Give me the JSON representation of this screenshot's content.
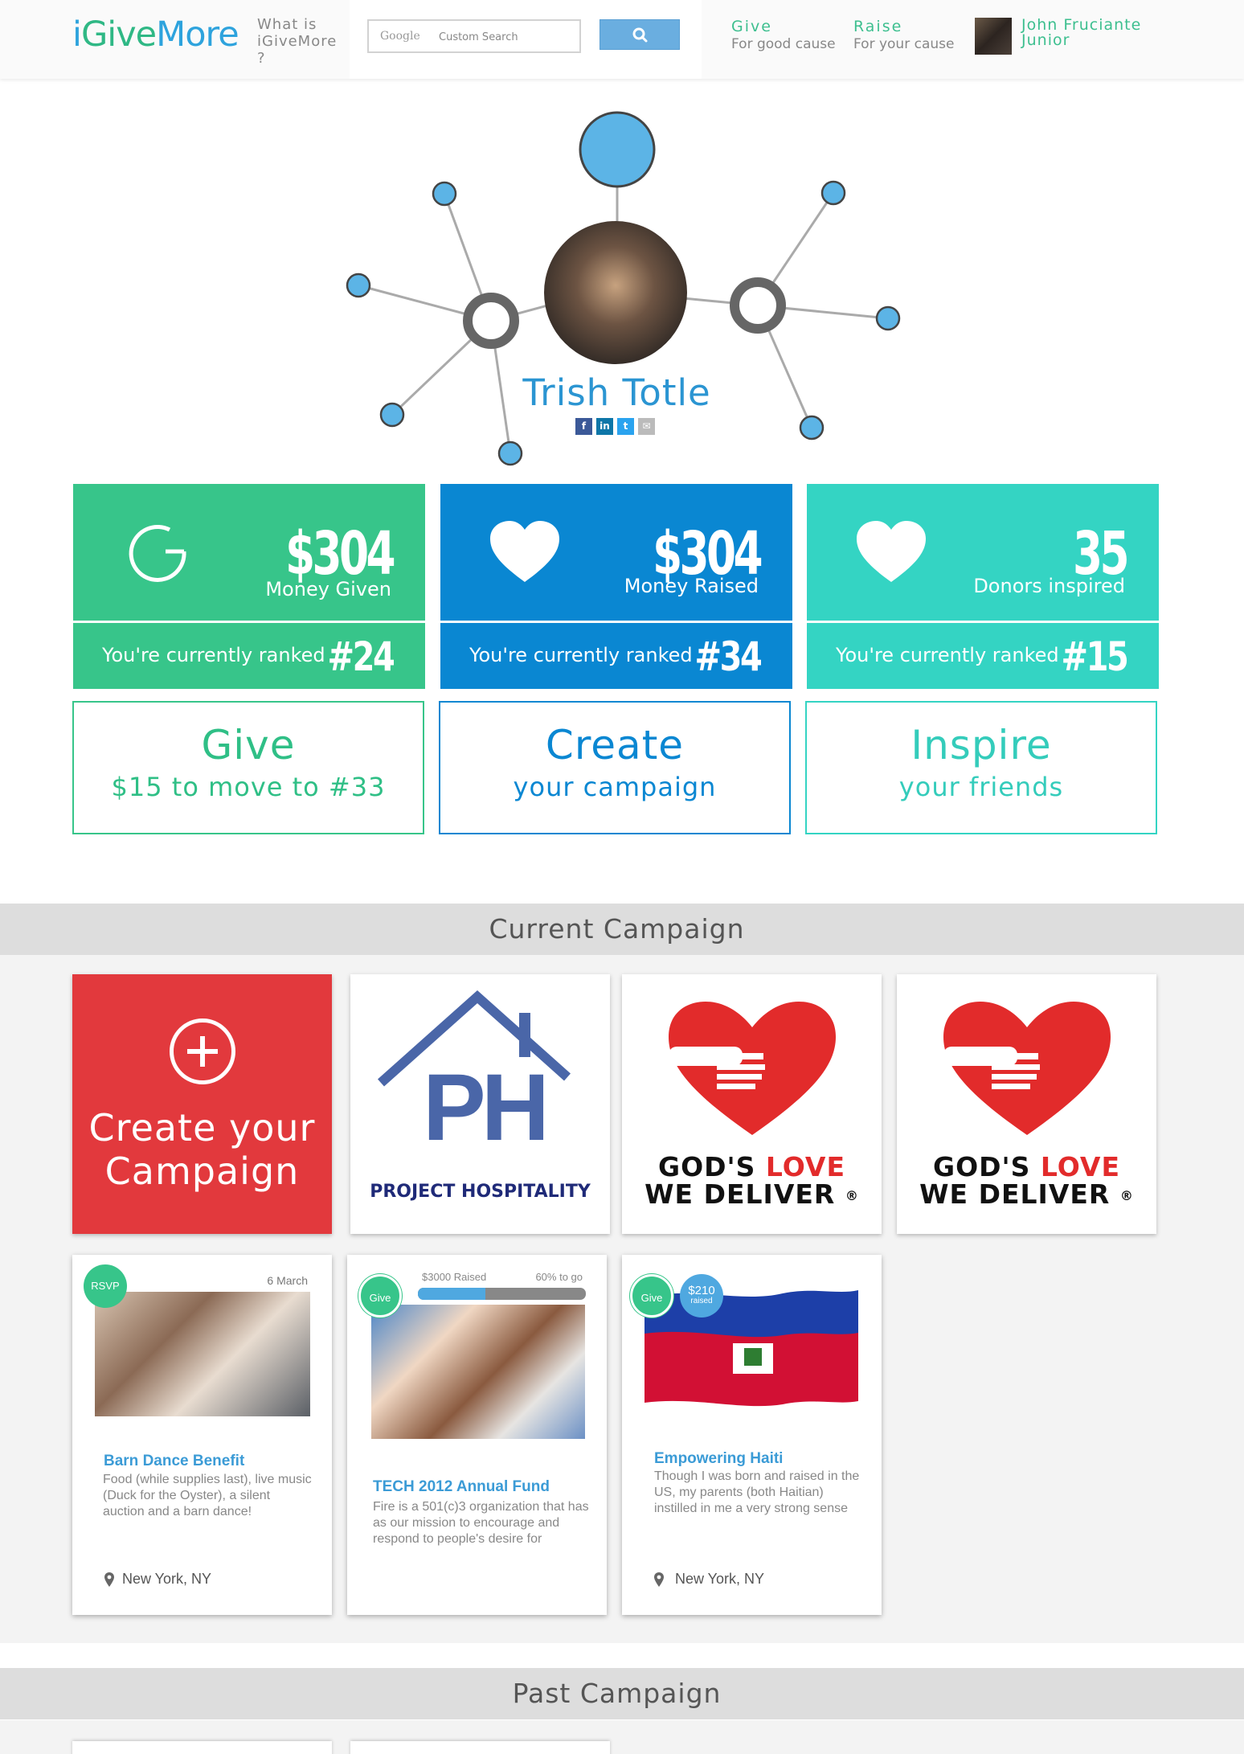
{
  "header": {
    "logo": {
      "i": "i",
      "give": "Give",
      "more": "More"
    },
    "what_is": "What is iGiveMore ?",
    "search": {
      "google_label": "Google",
      "placeholder": "Custom Search"
    },
    "nav": [
      {
        "title": "Give",
        "subtitle": "For good cause"
      },
      {
        "title": "Raise",
        "subtitle": "For your cause"
      }
    ],
    "user": {
      "name_line1": "John Fruciante",
      "name_line2": "Junior"
    }
  },
  "profile": {
    "name": "Trish Totle",
    "socials": [
      "f",
      "in",
      "t",
      "✉"
    ]
  },
  "stats": [
    {
      "amount": "$304",
      "label": "Money Given",
      "rank_text": "You're currently ranked",
      "rank": "#24",
      "icon": "give-logo-icon",
      "color": "#37c58a"
    },
    {
      "amount": "$304",
      "label": "Money Raised",
      "rank_text": "You're currently ranked",
      "rank": "#34",
      "icon": "heart-icon",
      "color": "#0a87d2"
    },
    {
      "amount": "35",
      "label": "Donors inspired",
      "rank_text": "You're currently ranked",
      "rank": "#15",
      "icon": "heart-icon",
      "color": "#34d4c3"
    }
  ],
  "actions": [
    {
      "title": "Give",
      "subtitle": "$15 to move to #33"
    },
    {
      "title": "Create",
      "subtitle": "your campaign"
    },
    {
      "title": "Inspire",
      "subtitle": "your friends"
    }
  ],
  "current_campaign": {
    "title": "Current Campaign",
    "create_tile": {
      "line1": "Create your",
      "line2": "Campaign"
    },
    "logos": [
      {
        "letters": "PH",
        "caption": "PROJECT HOSPITALITY"
      },
      {
        "line1_a": "GOD'S ",
        "line1_b": "LOVE",
        "line2": "WE DELIVER",
        "reg": "®"
      },
      {
        "line1_a": "GOD'S ",
        "line1_b": "LOVE",
        "line2": "WE DELIVER",
        "reg": "®"
      }
    ],
    "cards": [
      {
        "badge": "RSVP",
        "date": "6 March",
        "title": "Barn Dance Benefit",
        "description": "Food (while supplies last), live music (Duck for the Oyster), a silent auction and a barn dance!",
        "location": "New York, NY"
      },
      {
        "badge": "Give",
        "raised_label": "$3000 Raised",
        "to_go_label": "60% to go",
        "progress": 0.4,
        "title": "TECH 2012 Annual Fund",
        "description": "Fire is a 501(c)3 organization that has as our mission to encourage and respond to people's desire for"
      },
      {
        "badge": "Give",
        "raised_amount": "$210",
        "raised_word": "raised",
        "title": "Empowering Haiti",
        "description": "Though I was born and raised in the US, my parents (both Haitian) instilled in me a very strong sense",
        "location": "New York, NY"
      }
    ]
  },
  "past_campaign": {
    "title": "Past Campaign"
  }
}
